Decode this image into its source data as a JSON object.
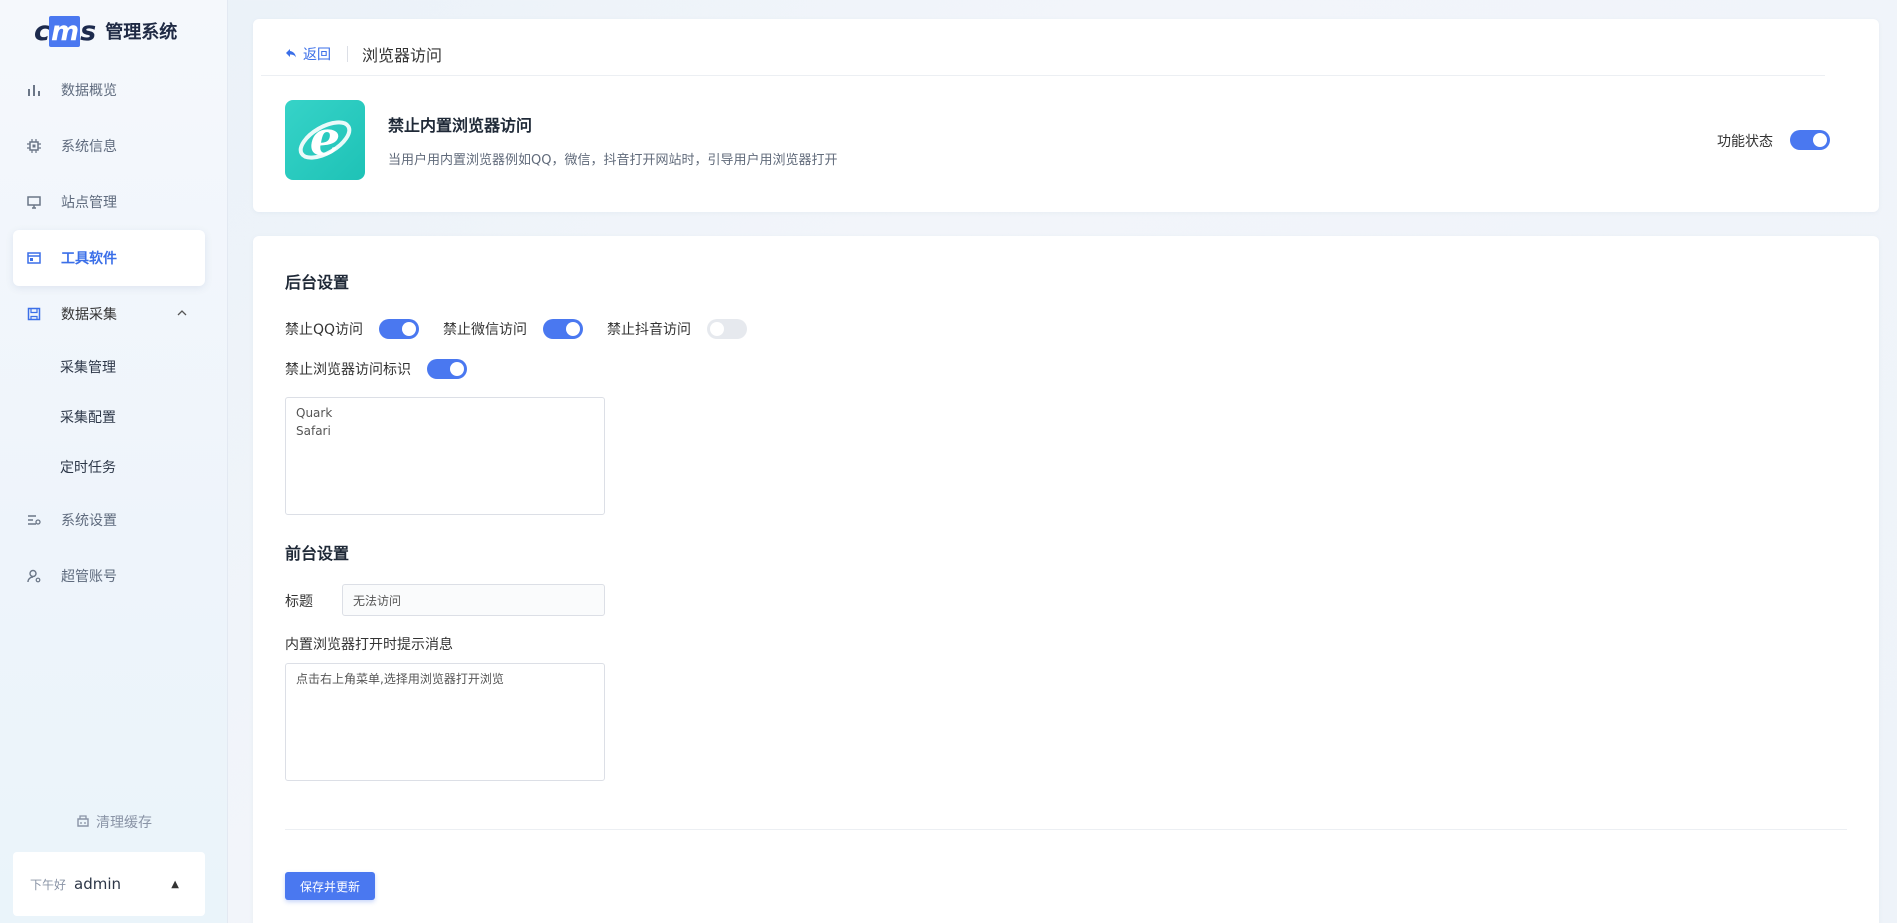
{
  "brand": {
    "logo": "cms",
    "title": "管理系统"
  },
  "sidebar": {
    "items": [
      {
        "label": "数据概览",
        "icon": "bar-chart-icon"
      },
      {
        "label": "系统信息",
        "icon": "chip-icon"
      },
      {
        "label": "站点管理",
        "icon": "monitor-icon"
      },
      {
        "label": "工具软件",
        "icon": "browser-window-icon",
        "active": true
      },
      {
        "label": "数据采集",
        "icon": "save-icon",
        "expanded": true
      }
    ],
    "sub_items": [
      "采集管理",
      "采集配置",
      "定时任务"
    ],
    "items_after": [
      {
        "label": "系统设置",
        "icon": "settings-sliders-icon"
      },
      {
        "label": "超管账号",
        "icon": "user-key-icon"
      }
    ],
    "clear_cache": "清理缓存",
    "greeting": "下午好",
    "username": "admin"
  },
  "header": {
    "back_label": "返回",
    "breadcrumb": "浏览器访问"
  },
  "feature": {
    "title": "禁止内置浏览器访问",
    "description": "当用户用内置浏览器例如QQ，微信，抖音打开网站时，引导用户用浏览器打开",
    "status_label": "功能状态",
    "status_on": true
  },
  "backend": {
    "title": "后台设置",
    "toggles": [
      {
        "label": "禁止QQ访问",
        "on": true
      },
      {
        "label": "禁止微信访问",
        "on": true
      },
      {
        "label": "禁止抖音访问",
        "on": false
      }
    ],
    "ua_toggle": {
      "label": "禁止浏览器访问标识",
      "on": true
    },
    "ua_list": "Quark\nSafari"
  },
  "frontend": {
    "title": "前台设置",
    "title_label": "标题",
    "title_value": "无法访问",
    "message_label": "内置浏览器打开时提示消息",
    "message_value": "点击右上角菜单,选择用浏览器打开浏览"
  },
  "actions": {
    "save_label": "保存并更新"
  },
  "colors": {
    "accent": "#4a78f0",
    "icon_bg": "#1ec2b6"
  }
}
